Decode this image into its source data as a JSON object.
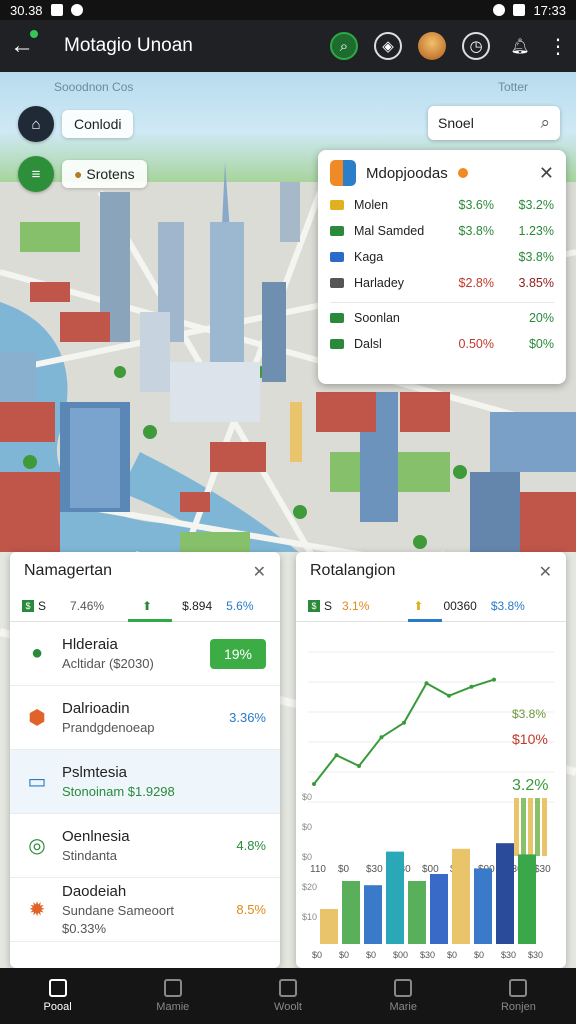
{
  "status": {
    "time": "30.38",
    "right_time": "17:33"
  },
  "appbar": {
    "title": "Motagio Unoan"
  },
  "map": {
    "label_left": "Sooodnon Cos",
    "label_right": "Totter",
    "chip_top": "Conlodi",
    "chip_bottom": "Srotens"
  },
  "search": {
    "placeholder": "Snoel"
  },
  "market": {
    "title": "Mdopjoodas",
    "rows": [
      {
        "name": "Molen",
        "v1": "$3.6%",
        "v2": "$3.2%",
        "color": "#e0b020",
        "v1_color": "#2a8a3a",
        "v2_color": "#2a8a3a"
      },
      {
        "name": "Mal Samded",
        "v1": "$3.8%",
        "v2": "1.23%",
        "color": "#2a8a3a",
        "v1_color": "#2a8a3a",
        "v2_color": "#2a8a3a"
      },
      {
        "name": "Kaga",
        "v1": "",
        "v2": "$3.8%",
        "color": "#2a6ac8",
        "v1_color": "#2a8a3a",
        "v2_color": "#2a8a3a"
      },
      {
        "name": "Harladey",
        "v1": "$2.8%",
        "v2": "3.85%",
        "color": "#555555",
        "v1_color": "#c0392b",
        "v2_color": "#8a1c1c"
      },
      {
        "name": "Soonlan",
        "v1": "",
        "v2": "20%",
        "color": "#2a8a3a",
        "v1_color": "#2a8a3a",
        "v2_color": "#2a8a3a"
      },
      {
        "name": "Dalsl",
        "v1": "0.50%",
        "v2": "$0%",
        "color": "#2a8a3a",
        "v1_color": "#c0392b",
        "v2_color": "#2a8a3a"
      }
    ]
  },
  "left_panel": {
    "title": "Namagertan",
    "stats": {
      "a": "S",
      "b": "7.46%",
      "c": "$.894",
      "d": "5.6%"
    },
    "rows": [
      {
        "t1": "Hlderaia",
        "t2": "Acltidar ($2030)",
        "val": "19%",
        "badge": true
      },
      {
        "t1": "Dalrioadin",
        "t2": "Prandgdenoeap",
        "val": "3.36%",
        "val_color": "#2a7ac8"
      },
      {
        "t1": "Pslmtesia",
        "t2": "Stonoinam $1.9298",
        "val": "",
        "highlight": true
      },
      {
        "t1": "Oenlnesia",
        "t2": "Stindanta",
        "val": "4.8%",
        "val_color": "#2a8a3a"
      },
      {
        "t1": "Daodeiah",
        "t2": "Sundane Sameoort",
        "t3": "$0.33%",
        "val": "8.5%",
        "val_color": "#e08a1a"
      }
    ]
  },
  "right_panel": {
    "title": "Rotalangion",
    "stats": {
      "a": "S",
      "b": "3.1%",
      "c": "00360",
      "d": "$3.8%"
    },
    "line_labels": {
      "top": "$3.8%",
      "red": "$10%",
      "green": "3.2%"
    }
  },
  "chart_data": {
    "type": "line",
    "x": [
      "110",
      "$0",
      "$30",
      "$30",
      "$00",
      "$00",
      "$00",
      "$30",
      "$30"
    ],
    "series": [
      {
        "values": [
          1.0,
          2.6,
          2.0,
          3.6,
          4.4,
          6.6,
          5.9,
          6.4,
          6.8
        ]
      }
    ],
    "bar_chart": {
      "type": "bar",
      "yticks": [
        "$10",
        "$20",
        "$0",
        "$0",
        "$0"
      ],
      "x": [
        "$0",
        "$0",
        "$0",
        "$00",
        "$30",
        "$0",
        "$0",
        "$30",
        "$30"
      ],
      "values": [
        2.5,
        4.5,
        4.2,
        6.6,
        4.5,
        5.0,
        6.8,
        5.4,
        7.2,
        6.4
      ]
    }
  },
  "bottom_nav": {
    "items": [
      {
        "label": "Pooal",
        "active": true
      },
      {
        "label": "Mamie"
      },
      {
        "label": "Woolt"
      },
      {
        "label": "Marie"
      },
      {
        "label": "Ronjen"
      }
    ]
  }
}
